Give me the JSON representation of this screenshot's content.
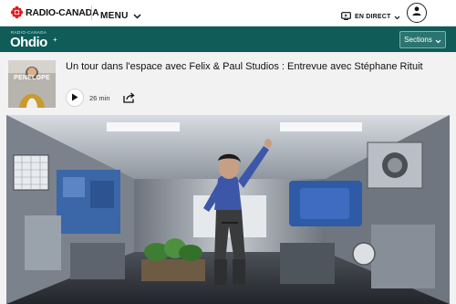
{
  "header": {
    "brand": "RADIO-CANADA",
    "menu_label": "MENU",
    "live_label": "EN DIRECT",
    "icons": [
      "radio-canada-logo-icon",
      "chevron-down-icon",
      "tv-icon",
      "user-icon"
    ]
  },
  "banner": {
    "brand_small": "RADIO-CANADA",
    "brand_big": "Ohdio",
    "brand_plus": "+",
    "sections_label": "Sections"
  },
  "episode": {
    "thumbnail_title": "PENELOPE",
    "title": "Un tour dans l'espace avec Felix & Paul Studios : Entrevue avec Stéphane Rituit",
    "duration": "26 min",
    "icons": [
      "play-icon",
      "share-icon"
    ]
  },
  "colors": {
    "banner": "#0f5c58",
    "brand_red": "#e31b23"
  }
}
